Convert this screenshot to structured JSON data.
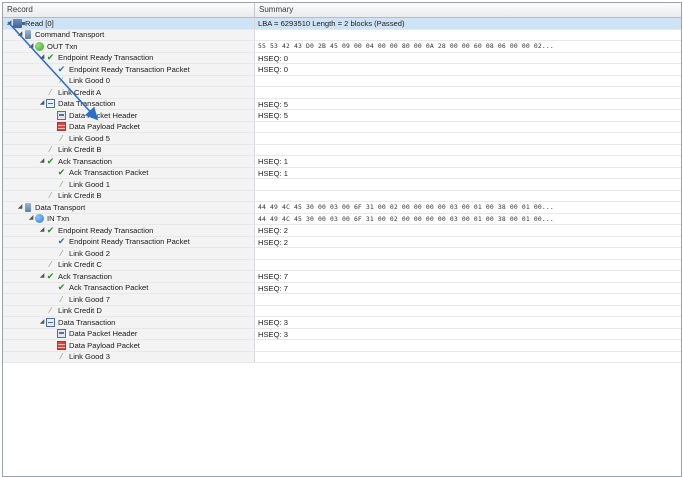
{
  "columns": {
    "record": "Record",
    "summary": "Summary"
  },
  "rows": [
    {
      "label": "Read [0]",
      "summary": "LBA = 6293510 Length = 2 blocks (Passed)",
      "depth": 0,
      "toggle": "expanded",
      "icon": "read-icon",
      "hex": false,
      "selected": true
    },
    {
      "label": "Command Transport",
      "summary": "",
      "depth": 1,
      "toggle": "expanded",
      "icon": "transport-icon",
      "hex": false
    },
    {
      "label": "OUT Txn",
      "summary": "55 53 42 43 D0 2B 45 09 00 04 00 00 80 00 0A 28 00 00 60 08 06 00 00 02...",
      "depth": 2,
      "toggle": "expanded",
      "icon": "out-txn-icon",
      "hex": true
    },
    {
      "label": "Endpoint Ready Transaction",
      "summary": "HSEQ: 0",
      "depth": 3,
      "toggle": "expanded",
      "icon": "check-icon",
      "hex": false
    },
    {
      "label": "Endpoint Ready Transaction Packet",
      "summary": "HSEQ: 0",
      "depth": 4,
      "toggle": "none",
      "icon": "check-blue-icon",
      "hex": false
    },
    {
      "label": "Link Good 0",
      "summary": "",
      "depth": 4,
      "toggle": "none",
      "icon": "link-icon",
      "hex": false
    },
    {
      "label": "Link Credit A",
      "summary": "",
      "depth": 3,
      "toggle": "none",
      "icon": "link-gray-icon",
      "hex": false
    },
    {
      "label": "Data Transaction",
      "summary": "HSEQ: 5",
      "depth": 3,
      "toggle": "expanded",
      "icon": "data-transaction-icon",
      "hex": false
    },
    {
      "label": "Data Packet Header",
      "summary": "HSEQ: 5",
      "depth": 4,
      "toggle": "none",
      "icon": "packet-header-icon",
      "hex": false
    },
    {
      "label": "Data Payload Packet",
      "summary": "",
      "depth": 4,
      "toggle": "none",
      "icon": "payload-icon",
      "hex": false
    },
    {
      "label": "Link Good 5",
      "summary": "",
      "depth": 4,
      "toggle": "none",
      "icon": "link-icon",
      "hex": false
    },
    {
      "label": "Link Credit B",
      "summary": "",
      "depth": 3,
      "toggle": "none",
      "icon": "link-gray-icon",
      "hex": false
    },
    {
      "label": "Ack Transaction",
      "summary": "HSEQ: 1",
      "depth": 3,
      "toggle": "expanded",
      "icon": "check-icon",
      "hex": false
    },
    {
      "label": "Ack Transaction Packet",
      "summary": "HSEQ: 1",
      "depth": 4,
      "toggle": "none",
      "icon": "check-icon",
      "hex": false
    },
    {
      "label": "Link Good 1",
      "summary": "",
      "depth": 4,
      "toggle": "none",
      "icon": "link-icon",
      "hex": false
    },
    {
      "label": "Link Credit B",
      "summary": "",
      "depth": 3,
      "toggle": "none",
      "icon": "link-gray-icon",
      "hex": false
    },
    {
      "label": "Data Transport",
      "summary": "44 49 4C 45 30 00 03 00 6F 31 00 02 00 00 00 00 03 00 01 00 38 00 01 00...",
      "depth": 1,
      "toggle": "expanded",
      "icon": "transport-icon",
      "hex": true
    },
    {
      "label": "IN Txn",
      "summary": "44 49 4C 45 30 00 03 00 6F 31 00 02 00 00 00 00 03 00 01 00 38 00 01 00...",
      "depth": 2,
      "toggle": "expanded",
      "icon": "in-txn-icon",
      "hex": true
    },
    {
      "label": "Endpoint Ready Transaction",
      "summary": "HSEQ: 2",
      "depth": 3,
      "toggle": "expanded",
      "icon": "check-icon",
      "hex": false
    },
    {
      "label": "Endpoint Ready Transaction Packet",
      "summary": "HSEQ: 2",
      "depth": 4,
      "toggle": "none",
      "icon": "check-blue-icon",
      "hex": false
    },
    {
      "label": "Link Good 2",
      "summary": "",
      "depth": 4,
      "toggle": "none",
      "icon": "link-icon",
      "hex": false
    },
    {
      "label": "Link Credit C",
      "summary": "",
      "depth": 3,
      "toggle": "none",
      "icon": "link-gray-icon",
      "hex": false
    },
    {
      "label": "Ack Transaction",
      "summary": "HSEQ: 7",
      "depth": 3,
      "toggle": "expanded",
      "icon": "check-icon",
      "hex": false
    },
    {
      "label": "Ack Transaction Packet",
      "summary": "HSEQ: 7",
      "depth": 4,
      "toggle": "none",
      "icon": "check-icon",
      "hex": false
    },
    {
      "label": "Link Good 7",
      "summary": "",
      "depth": 4,
      "toggle": "none",
      "icon": "link-icon",
      "hex": false
    },
    {
      "label": "Link Credit D",
      "summary": "",
      "depth": 3,
      "toggle": "none",
      "icon": "link-gray-icon",
      "hex": false
    },
    {
      "label": "Data Transaction",
      "summary": "HSEQ: 3",
      "depth": 3,
      "toggle": "expanded",
      "icon": "data-transaction-icon",
      "hex": false
    },
    {
      "label": "Data Packet Header",
      "summary": "HSEQ: 3",
      "depth": 4,
      "toggle": "none",
      "icon": "packet-header-icon",
      "hex": false
    },
    {
      "label": "Data Payload Packet",
      "summary": "",
      "depth": 4,
      "toggle": "none",
      "icon": "payload-icon",
      "hex": false
    },
    {
      "label": "Link Good 3",
      "summary": "",
      "depth": 4,
      "toggle": "none",
      "icon": "link-icon",
      "hex": false
    }
  ],
  "colors": {
    "selected_row": "#cfe3f7",
    "arrow": "#2a6fc9"
  }
}
